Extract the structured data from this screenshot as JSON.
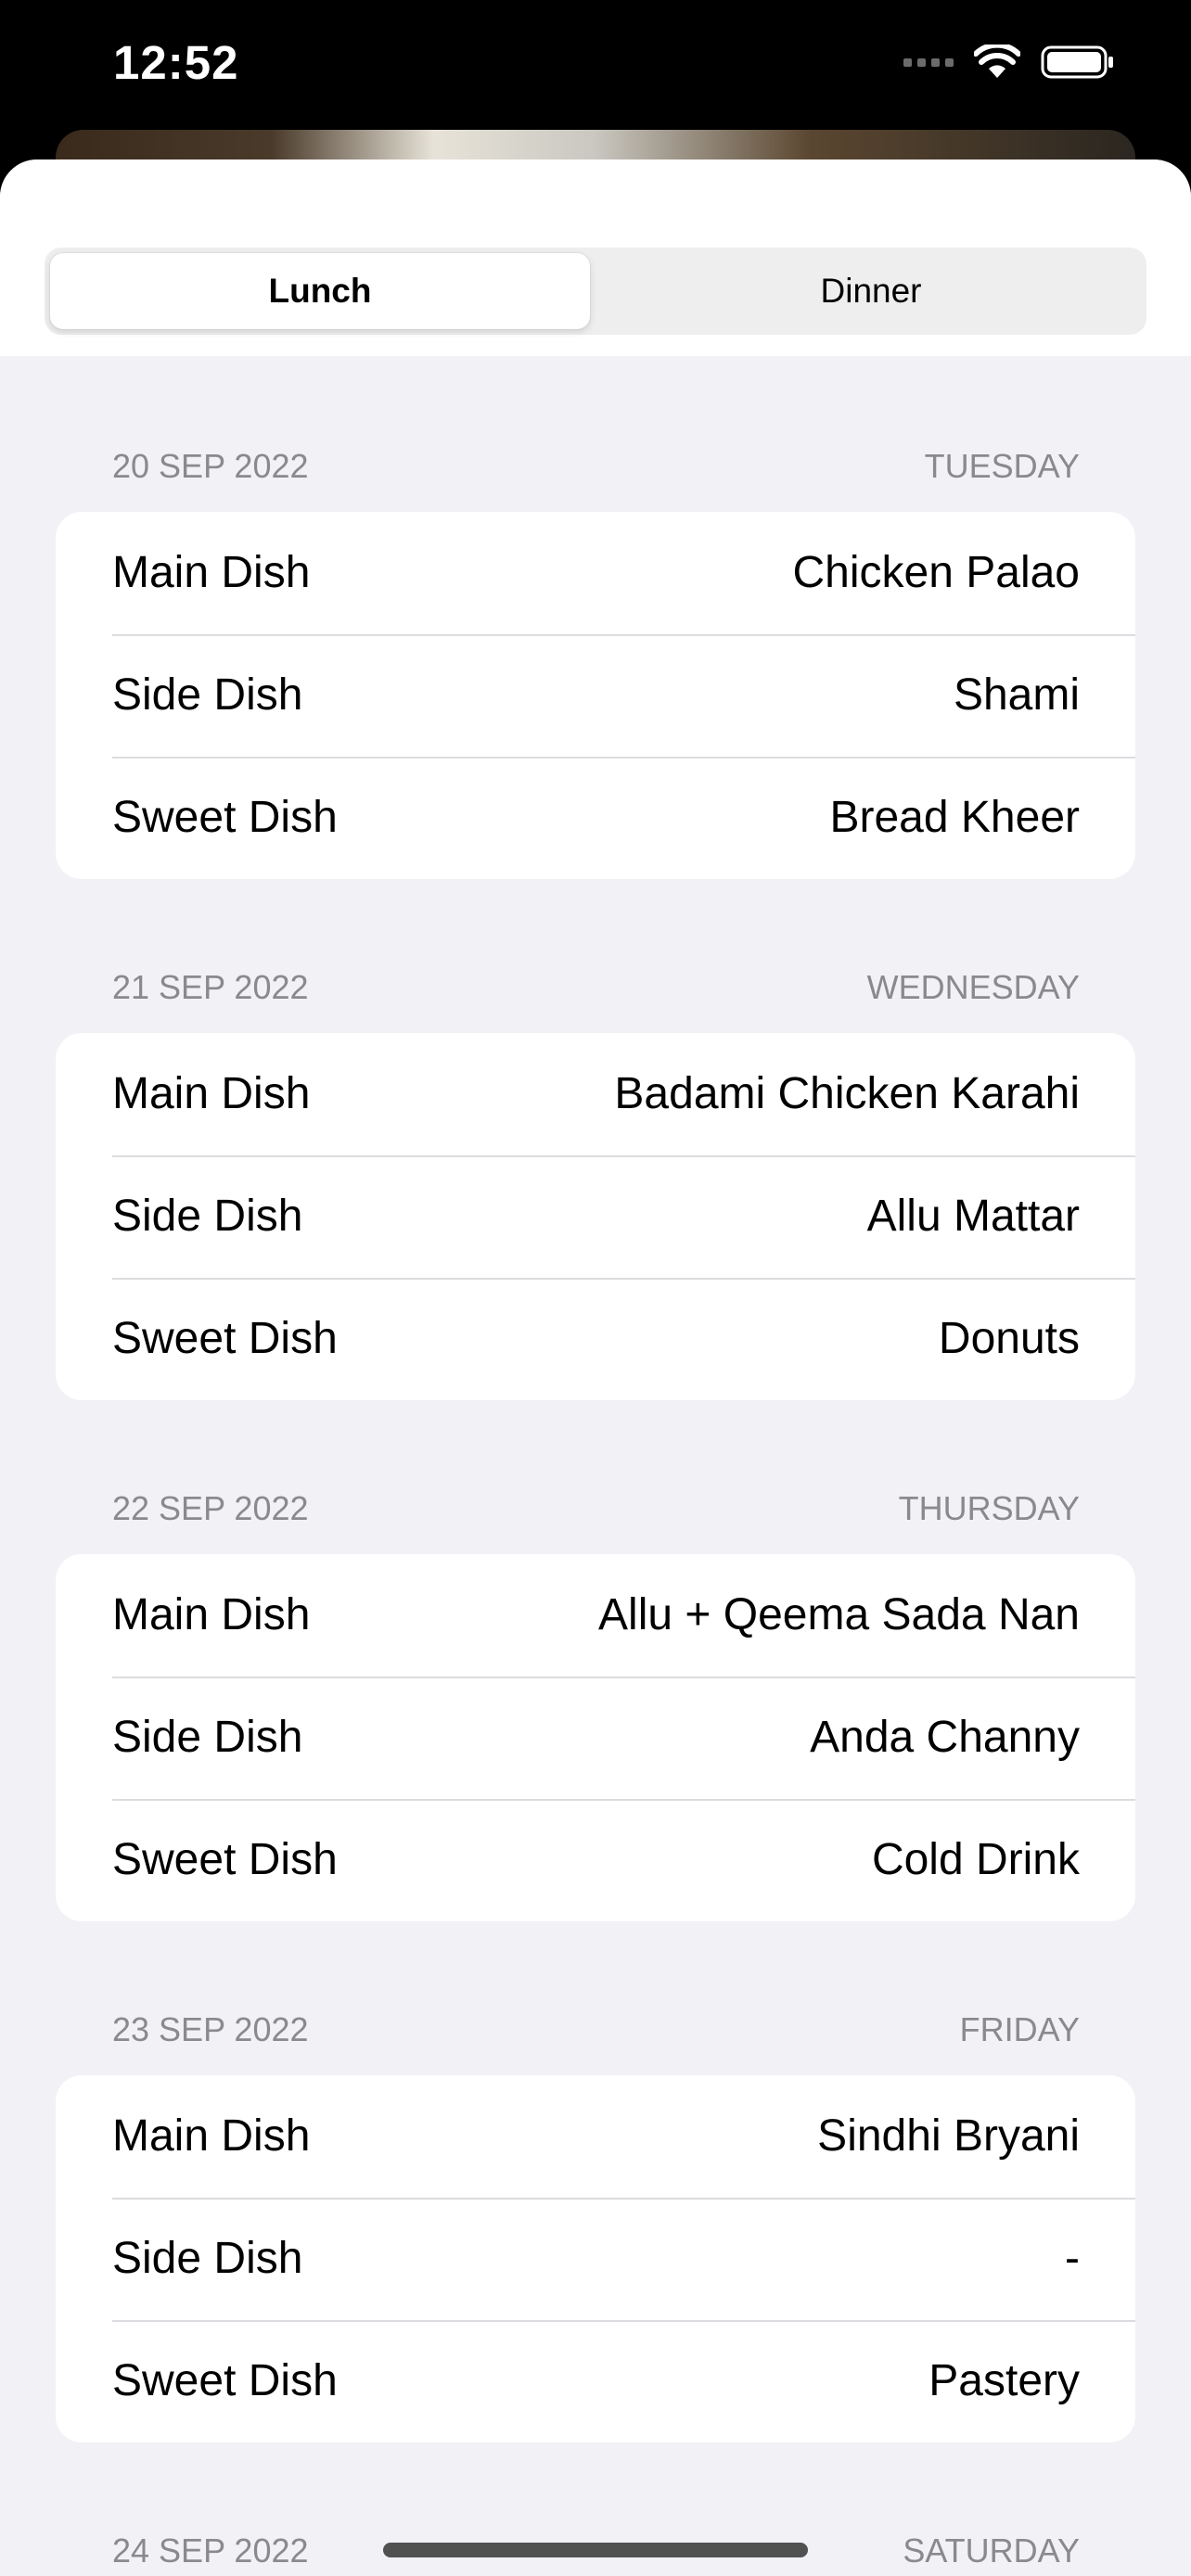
{
  "status_bar": {
    "time": "12:52"
  },
  "segmented_control": {
    "options": [
      "Lunch",
      "Dinner"
    ],
    "selected": "Lunch"
  },
  "days": [
    {
      "date": "20 SEP 2022",
      "weekday": "TUESDAY",
      "rows": [
        {
          "label": "Main Dish",
          "value": "Chicken Palao"
        },
        {
          "label": "Side Dish",
          "value": "Shami"
        },
        {
          "label": "Sweet Dish",
          "value": "Bread Kheer"
        }
      ]
    },
    {
      "date": "21 SEP 2022",
      "weekday": "WEDNESDAY",
      "rows": [
        {
          "label": "Main Dish",
          "value": "Badami Chicken Karahi"
        },
        {
          "label": "Side Dish",
          "value": "Allu Mattar"
        },
        {
          "label": "Sweet Dish",
          "value": "Donuts"
        }
      ]
    },
    {
      "date": "22 SEP 2022",
      "weekday": "THURSDAY",
      "rows": [
        {
          "label": "Main Dish",
          "value": "Allu + Qeema Sada Nan"
        },
        {
          "label": "Side Dish",
          "value": "Anda Channy"
        },
        {
          "label": "Sweet Dish",
          "value": "Cold Drink"
        }
      ]
    },
    {
      "date": "23 SEP 2022",
      "weekday": "FRIDAY",
      "rows": [
        {
          "label": "Main Dish",
          "value": "Sindhi Bryani"
        },
        {
          "label": "Side Dish",
          "value": "-"
        },
        {
          "label": "Sweet Dish",
          "value": "Pastery"
        }
      ]
    },
    {
      "date": "24 SEP 2022",
      "weekday": "SATURDAY",
      "rows": []
    }
  ]
}
